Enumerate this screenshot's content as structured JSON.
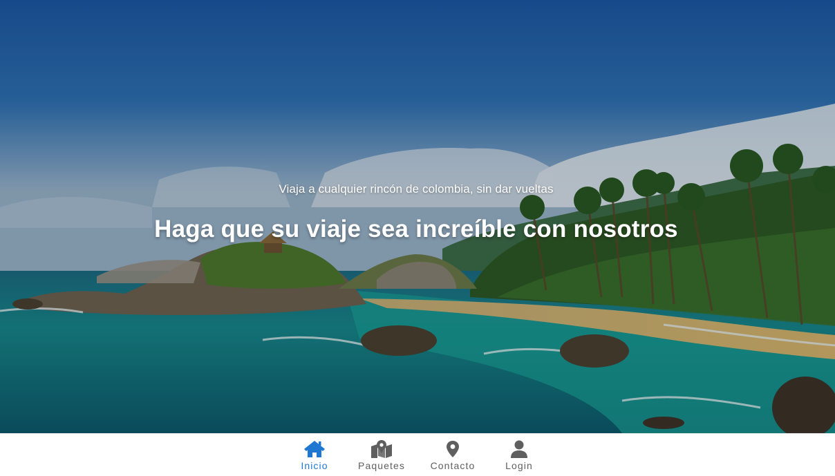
{
  "hero": {
    "subtitle": "Viaja a cualquier rincón de colombia, sin dar vueltas",
    "title": "Haga que su viaje sea increíble con nosotros"
  },
  "nav": {
    "items": [
      {
        "label": "Inicio",
        "icon": "home-icon",
        "active": true
      },
      {
        "label": "Paquetes",
        "icon": "map-marker-icon",
        "active": false
      },
      {
        "label": "Contacto",
        "icon": "location-pin-icon",
        "active": false
      },
      {
        "label": "Login",
        "icon": "user-icon",
        "active": false
      }
    ]
  },
  "colors": {
    "active": "#1e78d2",
    "inactive": "#5f5f5f"
  }
}
